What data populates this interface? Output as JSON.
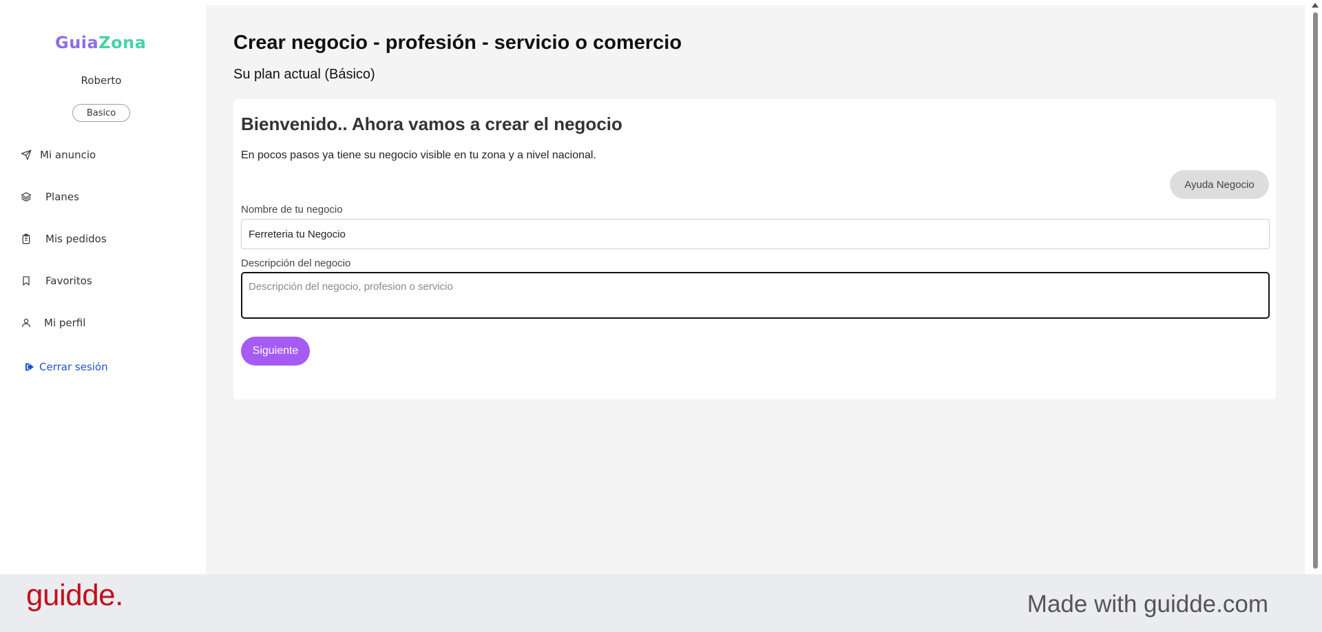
{
  "brand": {
    "logo_part1": "Guia",
    "logo_part2": "Zona"
  },
  "user": {
    "name": "Roberto",
    "plan_badge": "Basico"
  },
  "sidebar": {
    "items": [
      {
        "label": "Mi anuncio",
        "icon": "send-icon"
      },
      {
        "label": "Planes",
        "icon": "layers-icon"
      },
      {
        "label": "Mis pedidos",
        "icon": "clipboard-icon"
      },
      {
        "label": "Favoritos",
        "icon": "bookmark-icon"
      },
      {
        "label": "Mi perfil",
        "icon": "person-icon"
      }
    ],
    "logout": {
      "label": "Cerrar sesión",
      "icon": "sign-out-icon",
      "color": "#1a56c9"
    }
  },
  "main": {
    "title": "Crear negocio - profesión - servicio o comercio",
    "plan_line": "Su plan actual (Básico)",
    "card": {
      "heading": "Bienvenido.. Ahora vamos a crear el negocio",
      "subheading": "En pocos pasos ya tiene su negocio visible en tu zona y a nivel nacional.",
      "help_button": "Ayuda Negocio",
      "name_label": "Nombre de tu negocio",
      "name_value": "Ferreteria tu Negocio",
      "description_label": "Descripción del negocio",
      "description_placeholder": "Descripción del negocio, profesion o servicio",
      "next_button": "Siguiente"
    }
  },
  "footer": {
    "logo": "guidde.",
    "made_with": "Made with guidde.com"
  },
  "colors": {
    "accent_purple": "#a65bf5",
    "logo_purple": "#8e6ee6",
    "logo_green": "#45d3a7",
    "guidde_red": "#c0111b"
  }
}
